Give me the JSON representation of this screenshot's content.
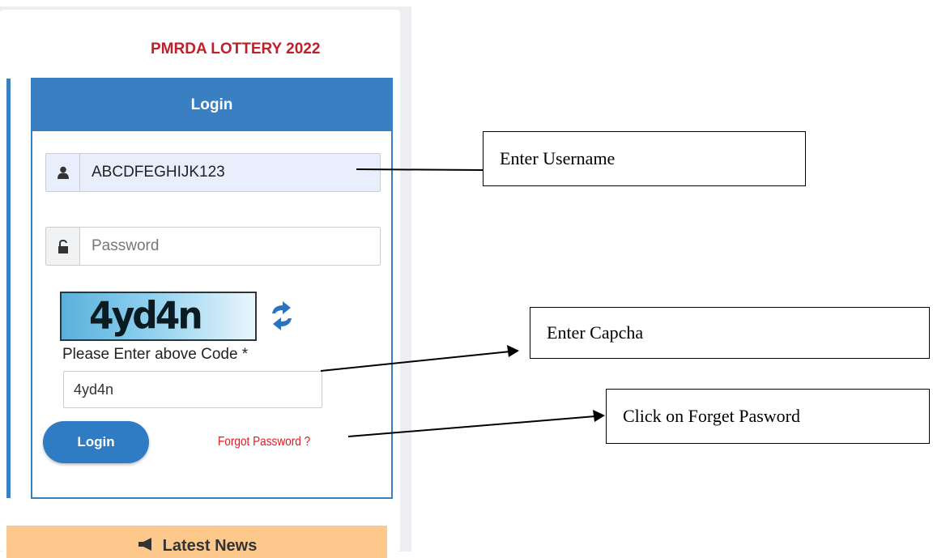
{
  "portal": {
    "title": "PMRDA LOTTERY 2022"
  },
  "login": {
    "header": "Login",
    "username_value": "ABCDFEGHIJK123",
    "password_placeholder": "Password",
    "captcha_code": "4yd4n",
    "captcha_label": "Please Enter above Code *",
    "captcha_input_value": "4yd4n",
    "login_button": "Login",
    "forgot_link": "Forgot Password ?"
  },
  "news": {
    "label": "Latest News"
  },
  "annotations": {
    "username": "Enter Username",
    "captcha": "Enter Capcha",
    "forgot": "Click on Forget Pasword"
  },
  "icons": [
    "user-icon",
    "lock-icon",
    "refresh-icon",
    "megaphone-icon"
  ],
  "colors": {
    "primary": "#3a7fc1",
    "title_red": "#c0202a",
    "forgot_red": "#e01a22",
    "news_bg": "#fdc88c",
    "username_bg": "#e8eefb"
  }
}
